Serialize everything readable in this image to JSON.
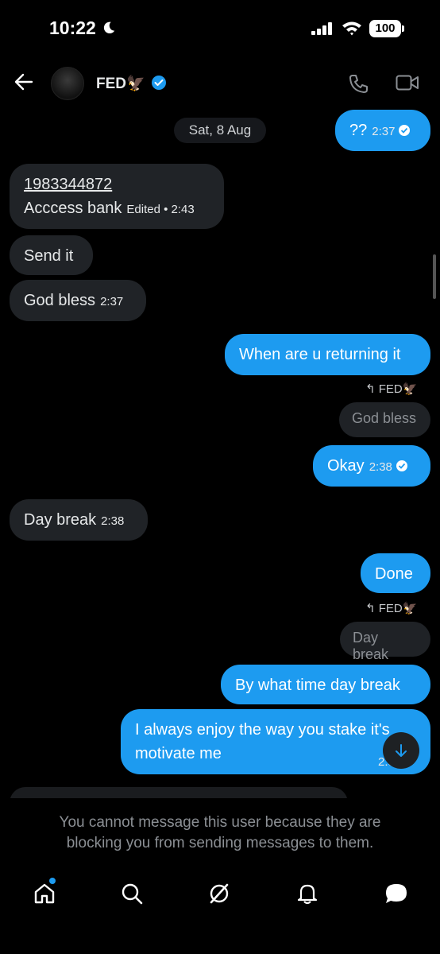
{
  "status_bar": {
    "time": "10:22",
    "battery": "100",
    "icons": [
      "moon-icon",
      "signal-icon",
      "wifi-icon",
      "battery-icon"
    ]
  },
  "header": {
    "name": "FED🦅",
    "verified": true,
    "icons": [
      "back-arrow-icon",
      "phone-icon",
      "video-icon",
      "verified-badge-icon"
    ]
  },
  "conversation": {
    "date_separator": "Sat, 8 Aug",
    "messages": [
      {
        "dir": "out",
        "text": "??",
        "time": "2:37",
        "read": true
      },
      {
        "dir": "in",
        "lines": [
          "1983344872",
          "Acccess bank"
        ],
        "meta": "Edited • 2:43"
      },
      {
        "dir": "in",
        "text": "Send it"
      },
      {
        "dir": "in",
        "text": "God bless",
        "time": "2:37"
      },
      {
        "dir": "out",
        "text": "When are u returning it"
      },
      {
        "dir": "out",
        "reply_to": "FED🦅",
        "quoted": "God bless",
        "text": "Okay",
        "time": "2:38",
        "read": true
      },
      {
        "dir": "in",
        "text": "Day break",
        "time": "2:38"
      },
      {
        "dir": "out",
        "text": "Done"
      },
      {
        "dir": "out",
        "reply_to": "FED🦅",
        "quoted": "Day break",
        "text": "By what time day break"
      },
      {
        "dir": "out",
        "lines": [
          "I always enjoy the way you stake it's",
          "motivate me"
        ],
        "time": "2:3"
      }
    ]
  },
  "footer": {
    "notice": "You cannot message this user because they are blocking you from sending messages to them.",
    "nav": [
      "home-icon",
      "search-icon",
      "grok-icon",
      "bell-icon",
      "messages-icon"
    ]
  },
  "colors": {
    "background": "#000000",
    "outgoing": "#1d9bf0",
    "incoming": "#202327",
    "muted_text": "#8b8f94"
  }
}
